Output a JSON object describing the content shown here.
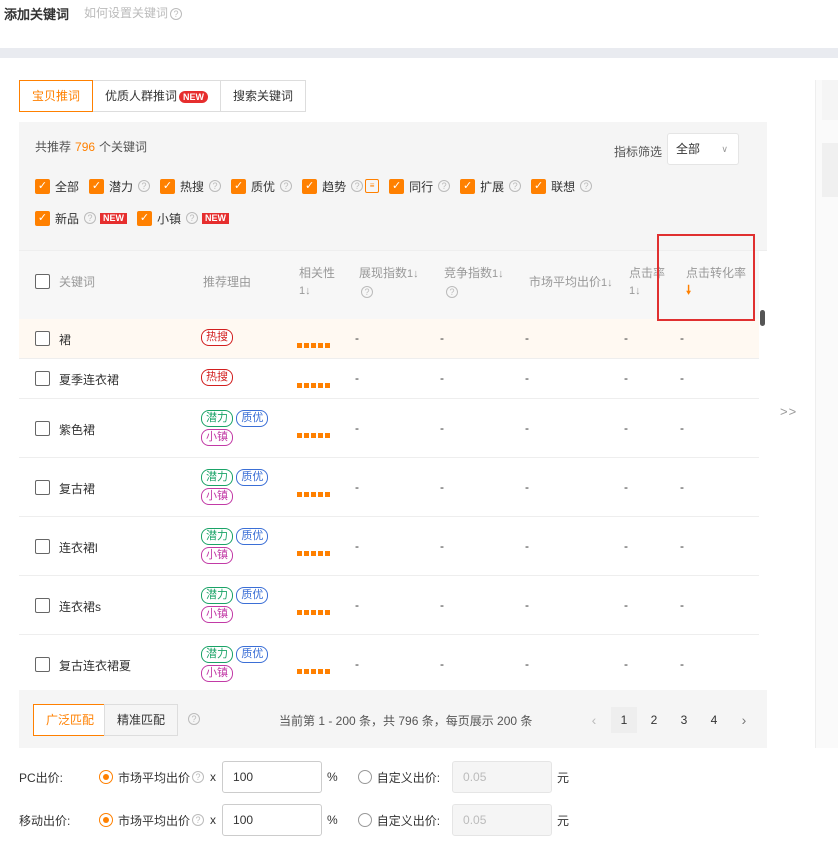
{
  "header": {
    "title": "添加关键词",
    "help_link": "如何设置关键词"
  },
  "tabs": [
    {
      "label": "宝贝推词",
      "active": true
    },
    {
      "label": "优质人群推词",
      "badge": "NEW"
    },
    {
      "label": "搜索关键词"
    }
  ],
  "summary": {
    "prefix": "共推荐",
    "count": "796",
    "suffix": "个关键词"
  },
  "filter": {
    "label": "指标筛选",
    "value": "全部"
  },
  "checkbox_filters": [
    {
      "label": "全部"
    },
    {
      "label": "潜力"
    },
    {
      "label": "热搜"
    },
    {
      "label": "质优"
    },
    {
      "label": "趋势"
    },
    {
      "label": "同行"
    },
    {
      "label": "扩展"
    },
    {
      "label": "联想"
    },
    {
      "label": "新品",
      "badge": "NEW"
    },
    {
      "label": "小镇",
      "badge": "NEW"
    }
  ],
  "table": {
    "headers": {
      "keyword": "关键词",
      "reason": "推荐理由",
      "relevance": "相关性",
      "impression": "展现指数",
      "competition": "竞争指数",
      "avg_bid": "市场平均出价",
      "ctr": "点击率",
      "cvr": "点击转化率"
    },
    "rows": [
      {
        "keyword": "裙",
        "tags": [
          "热搜"
        ],
        "impression": "-",
        "competition": "-",
        "avg_bid": "-",
        "ctr": "-",
        "cvr": "-"
      },
      {
        "keyword": "夏季连衣裙",
        "tags": [
          "热搜"
        ],
        "impression": "-",
        "competition": "-",
        "avg_bid": "-",
        "ctr": "-",
        "cvr": "-"
      },
      {
        "keyword": "紫色裙",
        "tags": [
          "潜力",
          "质优",
          "小镇"
        ],
        "impression": "-",
        "competition": "-",
        "avg_bid": "-",
        "ctr": "-",
        "cvr": "-"
      },
      {
        "keyword": "复古裙",
        "tags": [
          "潜力",
          "质优",
          "小镇"
        ],
        "impression": "-",
        "competition": "-",
        "avg_bid": "-",
        "ctr": "-",
        "cvr": "-"
      },
      {
        "keyword": "连衣裙l",
        "tags": [
          "潜力",
          "质优",
          "小镇"
        ],
        "impression": "-",
        "competition": "-",
        "avg_bid": "-",
        "ctr": "-",
        "cvr": "-"
      },
      {
        "keyword": "连衣裙s",
        "tags": [
          "潜力",
          "质优",
          "小镇"
        ],
        "impression": "-",
        "competition": "-",
        "avg_bid": "-",
        "ctr": "-",
        "cvr": "-"
      },
      {
        "keyword": "复古连衣裙夏",
        "tags": [
          "潜力",
          "质优",
          "小镇"
        ],
        "impression": "-",
        "competition": "-",
        "avg_bid": "-",
        "ctr": "-",
        "cvr": "-"
      }
    ]
  },
  "match": {
    "broad": "广泛匹配",
    "exact": "精准匹配"
  },
  "pagination": {
    "info": "当前第 1 - 200 条，共 796 条，每页展示 200 条",
    "pages": [
      "1",
      "2",
      "3",
      "4"
    ],
    "current": "1"
  },
  "expand_label": ">>",
  "bids": {
    "pc": {
      "label": "PC出价:",
      "market_label": "市场平均出价",
      "multiplier": "x",
      "value": "100",
      "unit": "%",
      "custom_label": "自定义出价:",
      "custom_placeholder": "0.05",
      "currency": "元"
    },
    "mobile": {
      "label": "移动出价:",
      "market_label": "市场平均出价",
      "multiplier": "x",
      "value": "100",
      "unit": "%",
      "custom_label": "自定义出价:",
      "custom_placeholder": "0.05",
      "currency": "元"
    }
  },
  "colors": {
    "accent": "#ff8000",
    "hot": "#d21f1f",
    "potential": "#1aa367",
    "quality": "#3b6fd6",
    "town": "#c23aa6",
    "highlight_box": "#e03030"
  }
}
